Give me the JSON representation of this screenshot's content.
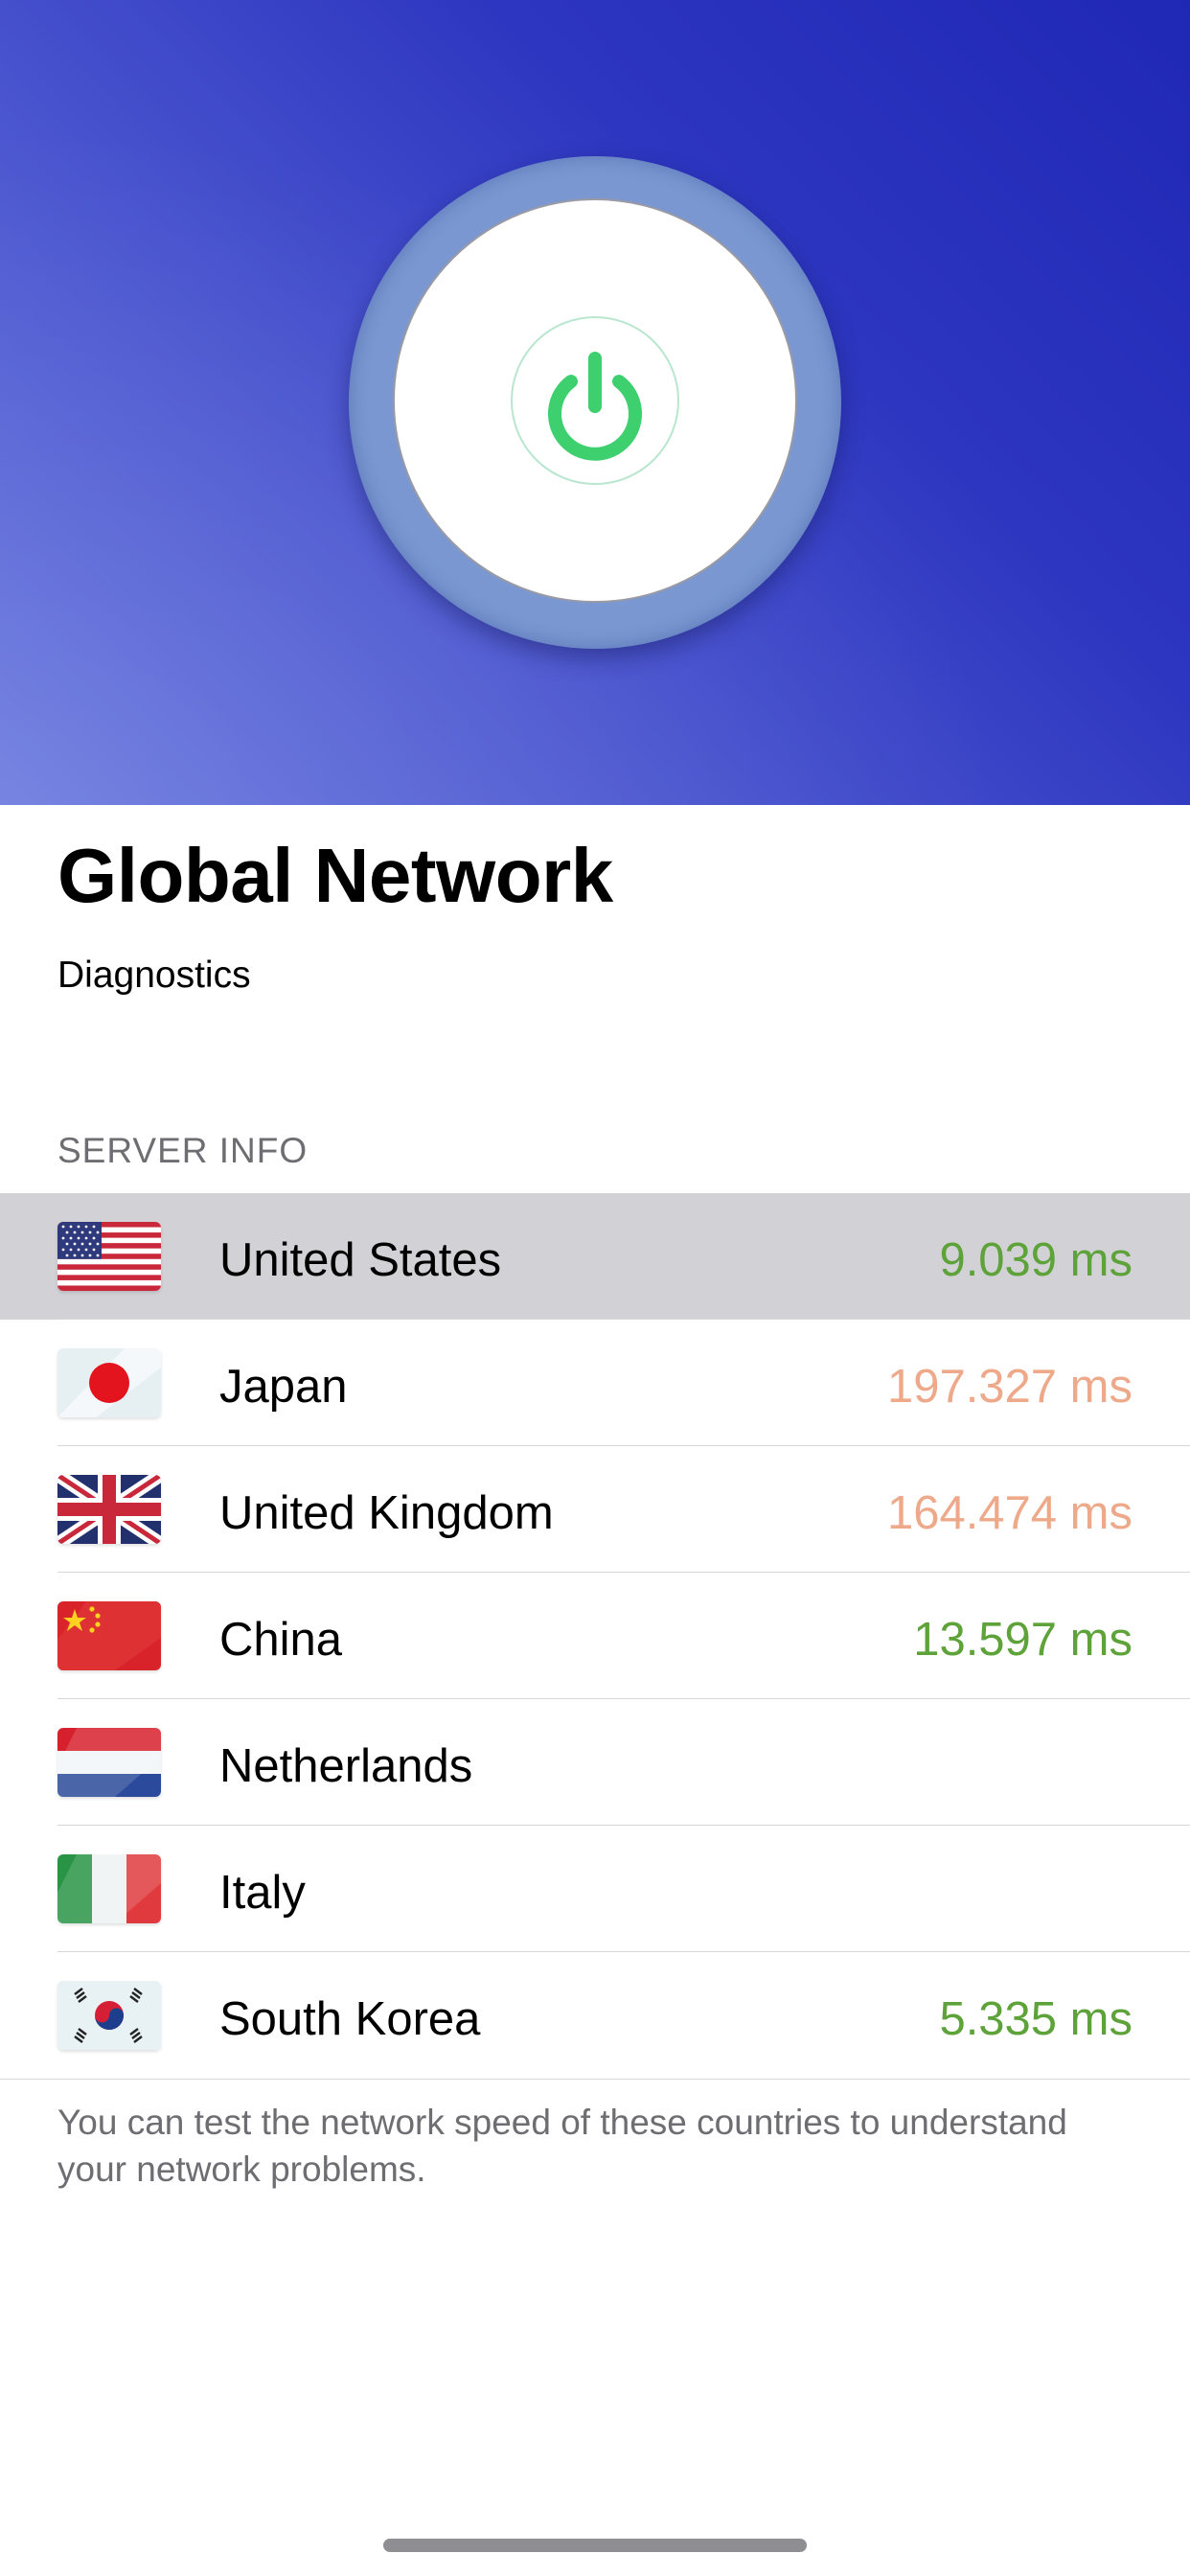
{
  "hero": {
    "power_button_state": "connected",
    "power_color": "#3ecf6e",
    "gradient_colors": [
      "#1f27b5",
      "#6877de"
    ]
  },
  "page": {
    "title": "Global Network",
    "subtitle": "Diagnostics"
  },
  "server_info": {
    "header": "SERVER INFO",
    "servers": [
      {
        "country": "United States",
        "latency": "9.039 ms",
        "status": "good",
        "flag": "us-flag-icon",
        "selected": true
      },
      {
        "country": "Japan",
        "latency": "197.327 ms",
        "status": "slow",
        "flag": "japan-flag-icon",
        "selected": false
      },
      {
        "country": "United Kingdom",
        "latency": "164.474 ms",
        "status": "slow",
        "flag": "uk-flag-icon",
        "selected": false
      },
      {
        "country": "China",
        "latency": "13.597 ms",
        "status": "good",
        "flag": "china-flag-icon",
        "selected": false
      },
      {
        "country": "Netherlands",
        "latency": "",
        "status": "none",
        "flag": "netherlands-flag-icon",
        "selected": false
      },
      {
        "country": "Italy",
        "latency": "",
        "status": "none",
        "flag": "italy-flag-icon",
        "selected": false
      },
      {
        "country": "South Korea",
        "latency": "5.335 ms",
        "status": "good",
        "flag": "south-korea-flag-icon",
        "selected": false
      }
    ],
    "footer": "You can test the network speed of these countries to understand your network problems."
  },
  "colors": {
    "latency_good": "#5ea33a",
    "latency_slow": "#eea98a",
    "selected_row": "#d1d1d6"
  }
}
